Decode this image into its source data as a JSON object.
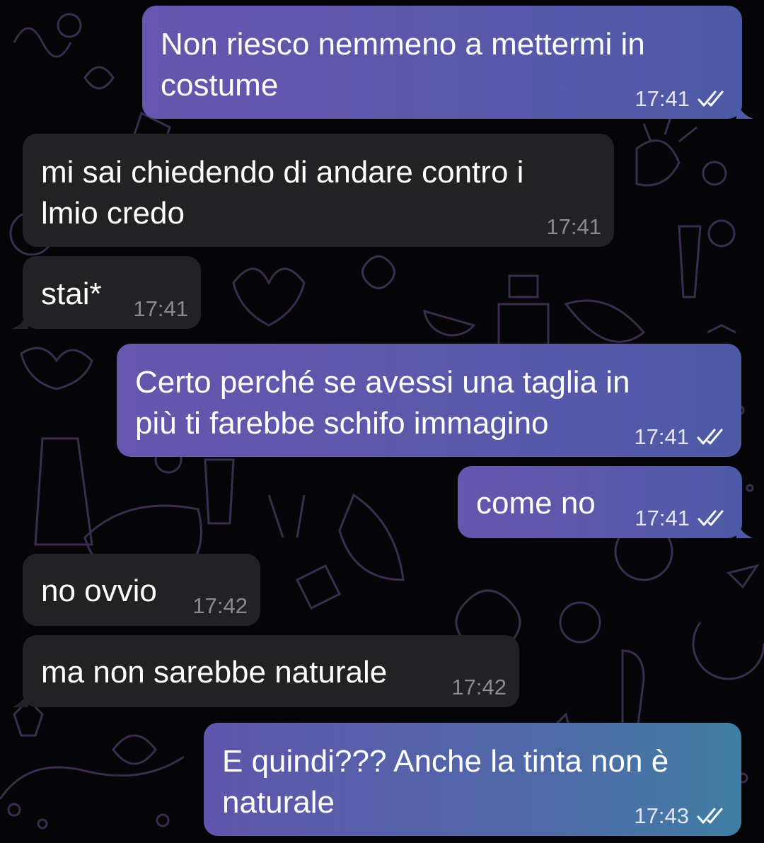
{
  "messages": [
    {
      "id": "m1",
      "direction": "outgoing",
      "lines": [
        "Non riesco nemmeno a mettermi in",
        "costume"
      ],
      "time": "17:41",
      "status_icon": "double-check-icon"
    },
    {
      "id": "m2",
      "direction": "incoming",
      "lines": [
        "mi sai chiedendo di andare contro i",
        "lmio credo"
      ],
      "time": "17:41"
    },
    {
      "id": "m3",
      "direction": "incoming",
      "lines": [
        "stai*"
      ],
      "time": "17:41"
    },
    {
      "id": "m4",
      "direction": "outgoing",
      "lines": [
        "Certo perché se avessi una taglia in",
        "più ti farebbe schifo immagino"
      ],
      "time": "17:41",
      "status_icon": "double-check-icon"
    },
    {
      "id": "m5",
      "direction": "outgoing",
      "lines": [
        "come no"
      ],
      "time": "17:41",
      "status_icon": "double-check-icon"
    },
    {
      "id": "m6",
      "direction": "incoming",
      "lines": [
        "no ovvio"
      ],
      "time": "17:42"
    },
    {
      "id": "m7",
      "direction": "incoming",
      "lines": [
        "ma non sarebbe naturale"
      ],
      "time": "17:42"
    },
    {
      "id": "m8",
      "direction": "outgoing",
      "lines": [
        "E quindi??? Anche la tinta non è",
        "naturale"
      ],
      "time": "17:43",
      "status_icon": "double-check-icon"
    }
  ],
  "theme": {
    "background": "#050507",
    "outgoing_bubble": "#5a58aa",
    "incoming_bubble": "#222225",
    "doodle_stroke": "#3a2c4e"
  }
}
